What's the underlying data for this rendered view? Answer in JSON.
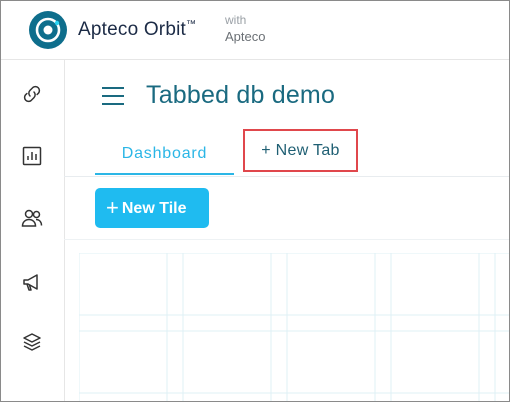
{
  "header": {
    "brand_name": "Apteco Orbit",
    "trademark": "™",
    "with_label": "with",
    "partner_name": "Apteco",
    "logo_icon": "orbit-logo-icon"
  },
  "sidebar": {
    "items": [
      {
        "icon": "link-icon"
      },
      {
        "icon": "bar-chart-icon"
      },
      {
        "icon": "people-icon"
      },
      {
        "icon": "megaphone-icon"
      },
      {
        "icon": "layers-icon"
      }
    ]
  },
  "main": {
    "menu_icon": "hamburger-menu-icon",
    "title": "Tabbed db demo",
    "tabs": [
      {
        "label": "Dashboard",
        "active": true
      },
      {
        "label": "+ New Tab",
        "active": false
      }
    ],
    "new_tile_button": {
      "plus": "+",
      "label": "New Tile"
    }
  },
  "colors": {
    "accent": "#2bb6e6",
    "button": "#1fbbf0",
    "title": "#1a6a80",
    "highlight_border": "#e0474c"
  }
}
